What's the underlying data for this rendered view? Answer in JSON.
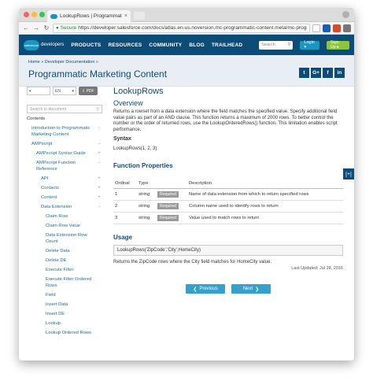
{
  "browser": {
    "tab_title": "LookupRows | Programmatic Ma",
    "tab_close": "×",
    "secure_label": "Secure",
    "url": "https://developer.salesforce.com/docs/atlas.en-us.noversion.mc-programmatic-content.meta/mc-programmati...",
    "back": "←",
    "forward": "→",
    "reload": "↻"
  },
  "header": {
    "logo_label": "salesforce",
    "brand_text": "developers",
    "nav": [
      "PRODUCTS",
      "RESOURCES",
      "COMMUNITY",
      "BLOG",
      "TRAILHEAD"
    ],
    "search_placeholder": "Search",
    "login_label": "Login ▾",
    "signup_label": "Sign Up ▸",
    "colors": {
      "brand": "#0e4c78",
      "accent": "#1798c1",
      "signup": "#8cc63f"
    }
  },
  "page": {
    "breadcrumb": "Home » Developer Documentation »",
    "title": "Programmatic Marketing Content",
    "social": [
      "t",
      "G+",
      "f",
      "in"
    ]
  },
  "sidebar": {
    "select_a": "▾",
    "select_lang": "EN",
    "pdf_label": "⇩ PDF",
    "search_placeholder": "Search in document",
    "toc": [
      {
        "label": "Contents",
        "toggle": "",
        "indent": 0
      },
      {
        "label": "Introduction to Programmatic Marketing Content",
        "toggle": "−",
        "indent": 1
      },
      {
        "label": "AMPscript",
        "toggle": "−",
        "indent": 1
      },
      {
        "label": "AMPscript Syntax Guide",
        "toggle": "+",
        "indent": 2
      },
      {
        "label": "AMPscript Function Reference",
        "toggle": "−",
        "indent": 2
      },
      {
        "label": "API",
        "toggle": "+",
        "indent": 3
      },
      {
        "label": "Contacts",
        "toggle": "+",
        "indent": 3
      },
      {
        "label": "Content",
        "toggle": "+",
        "indent": 3
      },
      {
        "label": "Data Extension",
        "toggle": "−",
        "indent": 3
      },
      {
        "label": "Claim Row",
        "toggle": "",
        "indent": 4
      },
      {
        "label": "Claim Row Value",
        "toggle": "",
        "indent": 4
      },
      {
        "label": "Data Extension Row Count",
        "toggle": "",
        "indent": 4
      },
      {
        "label": "Delete Data",
        "toggle": "",
        "indent": 4
      },
      {
        "label": "Delete DE",
        "toggle": "",
        "indent": 4
      },
      {
        "label": "Execute Filter",
        "toggle": "",
        "indent": 4
      },
      {
        "label": "Execute Filter Ordered Rows",
        "toggle": "",
        "indent": 4
      },
      {
        "label": "Field",
        "toggle": "",
        "indent": 4
      },
      {
        "label": "Insert Data",
        "toggle": "",
        "indent": 4
      },
      {
        "label": "Insert DE",
        "toggle": "",
        "indent": 4
      },
      {
        "label": "Lookup",
        "toggle": "",
        "indent": 4
      },
      {
        "label": "Lookup Ordered Rows",
        "toggle": "",
        "indent": 4
      }
    ]
  },
  "main": {
    "heading": "LookupRows",
    "overview_heading": "Overview",
    "overview_text": "Returns a rowset from a data extension where the field matches the specified value. Specify additional field value pairs as part of an AND clause. This function returns a maximum of 2000 rows. To better control the number or the order of returned rows, use the LookupOrderedRows() function. This limitation enables script performance.",
    "syntax_heading": "Syntax",
    "syntax_text": "LookupRows(1, 2, 3)",
    "props_heading": "Function Properties",
    "table": {
      "headers": [
        "Ordinal",
        "Type",
        "",
        "Description"
      ],
      "rows": [
        {
          "ordinal": "1",
          "type": "string",
          "badge": "Required",
          "description": "Name of data extension from which to return specified rows"
        },
        {
          "ordinal": "2",
          "type": "string",
          "badge": "Required",
          "description": "Column name used to identify rows to return"
        },
        {
          "ordinal": "3",
          "type": "string",
          "badge": "Required",
          "description": "Value used to match rows to return"
        }
      ]
    },
    "usage_heading": "Usage",
    "usage_code": "LookupRows('ZipCode','City',HomeCity)",
    "usage_text": "Returns the ZipCode rows where the City field matches for HomeCity value.",
    "last_updated": "Last Updated: Jul 28, 2016",
    "prev_label": "Previous",
    "next_label": "Next",
    "prev_icon": "❮",
    "next_icon": "❯"
  },
  "feedback_icon": "[+]"
}
